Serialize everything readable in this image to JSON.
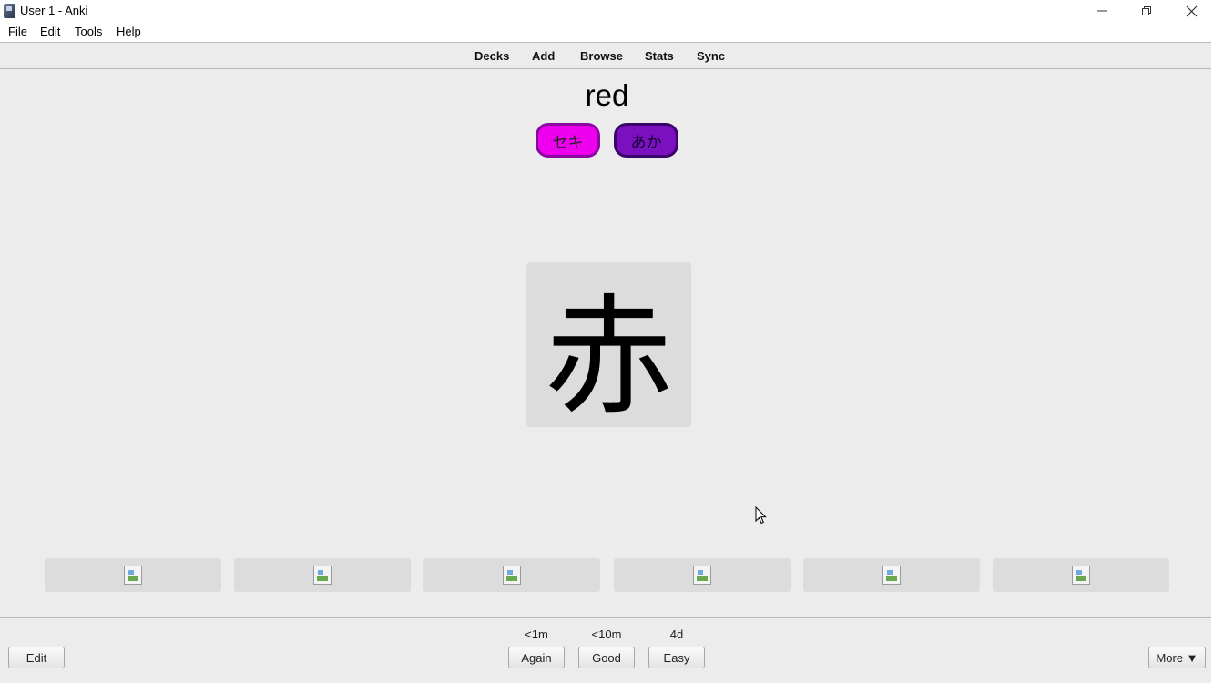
{
  "window": {
    "title": "User 1 - Anki",
    "app_icon": "anki-icon",
    "controls": {
      "minimize": "minimize-icon",
      "maximize": "restore-icon",
      "close": "close-icon"
    }
  },
  "menu": {
    "items": [
      {
        "label": "File"
      },
      {
        "label": "Edit"
      },
      {
        "label": "Tools"
      },
      {
        "label": "Help"
      }
    ]
  },
  "toolbar": {
    "links": [
      {
        "label": "Decks"
      },
      {
        "label": "Add"
      },
      {
        "label": "Browse"
      },
      {
        "label": "Stats"
      },
      {
        "label": "Sync"
      }
    ]
  },
  "card": {
    "meaning": "red",
    "on_reading": "セキ",
    "kun_reading": "あか",
    "kanji": "赤",
    "on_color": "#ee00ee",
    "kun_color": "#7a10c0",
    "image_slots": 6,
    "image_icon": "broken-image-icon"
  },
  "answer_bar": {
    "edit_label": "Edit",
    "more_label": "More ▼",
    "buttons": [
      {
        "label": "Again",
        "interval": "<1m"
      },
      {
        "label": "Good",
        "interval": "<10m"
      },
      {
        "label": "Easy",
        "interval": "4d"
      }
    ]
  }
}
